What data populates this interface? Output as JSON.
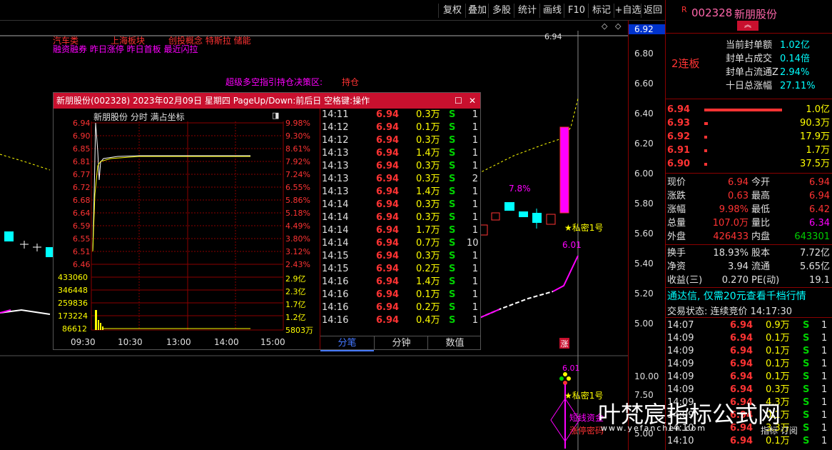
{
  "toolbar": {
    "buttons": [
      "复权",
      "叠加",
      "多股",
      "统计",
      "画线",
      "F10",
      "标记",
      "+自选",
      "返回"
    ]
  },
  "chart": {
    "hints_top": [
      "汽车类",
      "上海板块",
      "创投概念 特斯拉 储能"
    ],
    "hints_row2": "融资融券 昨日涨停 昨日首板 最近闪拉",
    "strategy_label": "超级多空指引持仓决策区:",
    "strategy_value": "持仓",
    "price_line_label": "6.94",
    "pct_label": "7.8%",
    "secret_label": "★私密1号",
    "low_label": "6.01",
    "zhang_label": "涨",
    "lower_low_label": "6.01",
    "lower_secret_label": "★私密1号",
    "lower_tag1": "短线资金",
    "lower_tag2": "涨停密码",
    "price_axis": [
      "6.92",
      "6.80",
      "6.60",
      "6.40",
      "6.20",
      "6.00",
      "5.80",
      "5.60",
      "5.40",
      "5.20",
      "5.00",
      "10.00",
      "7.50"
    ],
    "lower_axis_extra": "5.00"
  },
  "popup": {
    "title": "新朋股份(002328) 2023年02月09日 星期四 PageUp/Down:前后日 空格键:操作",
    "subtitle": "新朋股份  分时 满占坐标",
    "left_axis": [
      "6.94",
      "6.90",
      "6.85",
      "6.81",
      "6.77",
      "6.72",
      "6.68",
      "6.64",
      "6.59",
      "6.55",
      "6.51",
      "6.46"
    ],
    "right_axis": [
      "9.98%",
      "9.30%",
      "8.61%",
      "7.92%",
      "7.24%",
      "6.55%",
      "5.86%",
      "5.18%",
      "4.49%",
      "3.80%",
      "3.12%",
      "2.43%"
    ],
    "vol_left": [
      "433060",
      "346448",
      "259836",
      "173224",
      "86612"
    ],
    "vol_right": [
      "2.9亿",
      "2.3亿",
      "1.7亿",
      "1.2亿",
      "5803万"
    ],
    "time_axis": [
      "09:30",
      "10:30",
      "13:00",
      "14:00",
      "15:00"
    ],
    "ticks": [
      {
        "t": "14:11",
        "p": "6.94",
        "v": "0.3万",
        "bs": "S",
        "n": "1"
      },
      {
        "t": "14:12",
        "p": "6.94",
        "v": "0.1万",
        "bs": "S",
        "n": "1"
      },
      {
        "t": "14:12",
        "p": "6.94",
        "v": "0.3万",
        "bs": "S",
        "n": "1"
      },
      {
        "t": "14:13",
        "p": "6.94",
        "v": "1.4万",
        "bs": "S",
        "n": "1"
      },
      {
        "t": "14:13",
        "p": "6.94",
        "v": "0.3万",
        "bs": "S",
        "n": "1"
      },
      {
        "t": "14:13",
        "p": "6.94",
        "v": "0.3万",
        "bs": "S",
        "n": "2"
      },
      {
        "t": "14:13",
        "p": "6.94",
        "v": "1.4万",
        "bs": "S",
        "n": "1"
      },
      {
        "t": "14:14",
        "p": "6.94",
        "v": "0.3万",
        "bs": "S",
        "n": "1"
      },
      {
        "t": "14:14",
        "p": "6.94",
        "v": "0.3万",
        "bs": "S",
        "n": "1"
      },
      {
        "t": "14:14",
        "p": "6.94",
        "v": "1.7万",
        "bs": "S",
        "n": "1"
      },
      {
        "t": "14:14",
        "p": "6.94",
        "v": "0.7万",
        "bs": "S",
        "n": "10"
      },
      {
        "t": "14:15",
        "p": "6.94",
        "v": "0.3万",
        "bs": "S",
        "n": "1"
      },
      {
        "t": "14:15",
        "p": "6.94",
        "v": "0.2万",
        "bs": "S",
        "n": "1"
      },
      {
        "t": "14:16",
        "p": "6.94",
        "v": "1.4万",
        "bs": "S",
        "n": "1"
      },
      {
        "t": "14:16",
        "p": "6.94",
        "v": "0.1万",
        "bs": "S",
        "n": "1"
      },
      {
        "t": "14:16",
        "p": "6.94",
        "v": "0.2万",
        "bs": "S",
        "n": "1"
      },
      {
        "t": "14:16",
        "p": "6.94",
        "v": "0.4万",
        "bs": "S",
        "n": "1"
      }
    ],
    "tabs": [
      "分笔",
      "分钟",
      "数值"
    ]
  },
  "right_panel": {
    "code_prefix": "R",
    "code": "002328",
    "name": "新朋股份",
    "board": "2连板",
    "seal_rows": [
      {
        "label": "当前封单额",
        "value": "1.02亿"
      },
      {
        "label": "封单占成交",
        "value": "0.14倍"
      },
      {
        "label": "封单占流通Z",
        "value": "2.94%"
      },
      {
        "label": "十日总涨幅",
        "value": "27.11%"
      }
    ],
    "order_book": [
      {
        "p": "6.94",
        "v": "1.0亿",
        "bar": 0.4
      },
      {
        "p": "6.93",
        "v": "90.3万",
        "bar": 0.02
      },
      {
        "p": "6.92",
        "v": "17.9万",
        "bar": 0.01
      },
      {
        "p": "6.91",
        "v": "1.7万",
        "bar": 0.01
      },
      {
        "p": "6.90",
        "v": "37.5万",
        "bar": 0.01
      }
    ],
    "quote": [
      {
        "l1": "现价",
        "v1": "6.94",
        "l2": "今开",
        "v2": "6.94"
      },
      {
        "l1": "涨跌",
        "v1": "0.63",
        "l2": "最高",
        "v2": "6.94"
      },
      {
        "l1": "涨幅",
        "v1": "9.98%",
        "l2": "最低",
        "v2": "6.42"
      },
      {
        "l1": "总量",
        "v1": "107.0万",
        "l2": "量比",
        "v2": "6.34"
      },
      {
        "l1": "外盘",
        "v1": "426433",
        "l2": "内盘",
        "v2": "643301"
      }
    ],
    "fundamentals": [
      {
        "l1": "换手",
        "v1": "18.93%",
        "l2": "股本",
        "v2": "7.72亿"
      },
      {
        "l1": "净资",
        "v1": "3.94",
        "l2": "流通",
        "v2": "5.65亿"
      },
      {
        "l1": "收益(三)",
        "v1": "0.270",
        "l2": "PE(动)",
        "v2": "19.1"
      }
    ],
    "ad": "通达信, 仅需20元查看千档行情",
    "trade_status": "交易状态: 连续竞价 14:17:30",
    "trades": [
      {
        "t": "14:07",
        "p": "6.94",
        "v": "0.9万",
        "bs": "S",
        "n": "1"
      },
      {
        "t": "14:09",
        "p": "6.94",
        "v": "0.1万",
        "bs": "S",
        "n": "1"
      },
      {
        "t": "14:09",
        "p": "6.94",
        "v": "0.1万",
        "bs": "S",
        "n": "1"
      },
      {
        "t": "14:09",
        "p": "6.94",
        "v": "0.1万",
        "bs": "S",
        "n": "1"
      },
      {
        "t": "14:09",
        "p": "6.94",
        "v": "0.1万",
        "bs": "S",
        "n": "1"
      },
      {
        "t": "14:09",
        "p": "6.94",
        "v": "0.3万",
        "bs": "S",
        "n": "1"
      },
      {
        "t": "14:09",
        "p": "6.94",
        "v": "4.3万",
        "bs": "S",
        "n": "1"
      },
      {
        "t": "14:09",
        "p": "6.94",
        "v": "0.1万",
        "bs": "S",
        "n": "1"
      },
      {
        "t": "14:10",
        "p": "6.94",
        "v": "3.3万",
        "bs": "S",
        "n": "1"
      },
      {
        "t": "14:10",
        "p": "6.94",
        "v": "0.1万",
        "bs": "S",
        "n": "1"
      }
    ]
  },
  "watermark": {
    "text": "叶梵宸指标公式网",
    "url": "www.yefanchen.com",
    "tag": "指标 订阅"
  }
}
